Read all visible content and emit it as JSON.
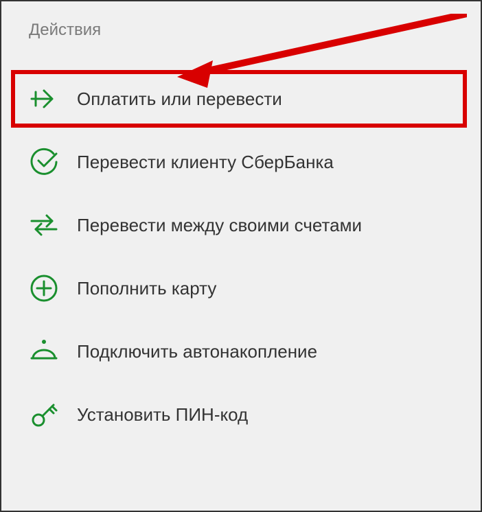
{
  "section": {
    "title": "Действия"
  },
  "colors": {
    "accent": "#1a8f2e",
    "highlight": "#d80000"
  },
  "actions": [
    {
      "id": "pay-or-transfer",
      "label": "Оплатить или перевести",
      "icon": "arrow-right",
      "highlighted": true
    },
    {
      "id": "transfer-sber",
      "label": "Перевести клиенту СберБанка",
      "icon": "check-circle",
      "highlighted": false
    },
    {
      "id": "transfer-own",
      "label": "Перевести между своими счетами",
      "icon": "arrows-exchange",
      "highlighted": false
    },
    {
      "id": "topup-card",
      "label": "Пополнить карту",
      "icon": "plus-circle",
      "highlighted": false
    },
    {
      "id": "auto-savings",
      "label": "Подключить автонакопление",
      "icon": "piggy-bank",
      "highlighted": false
    },
    {
      "id": "set-pin",
      "label": "Установить ПИН-код",
      "icon": "key",
      "highlighted": false
    }
  ]
}
